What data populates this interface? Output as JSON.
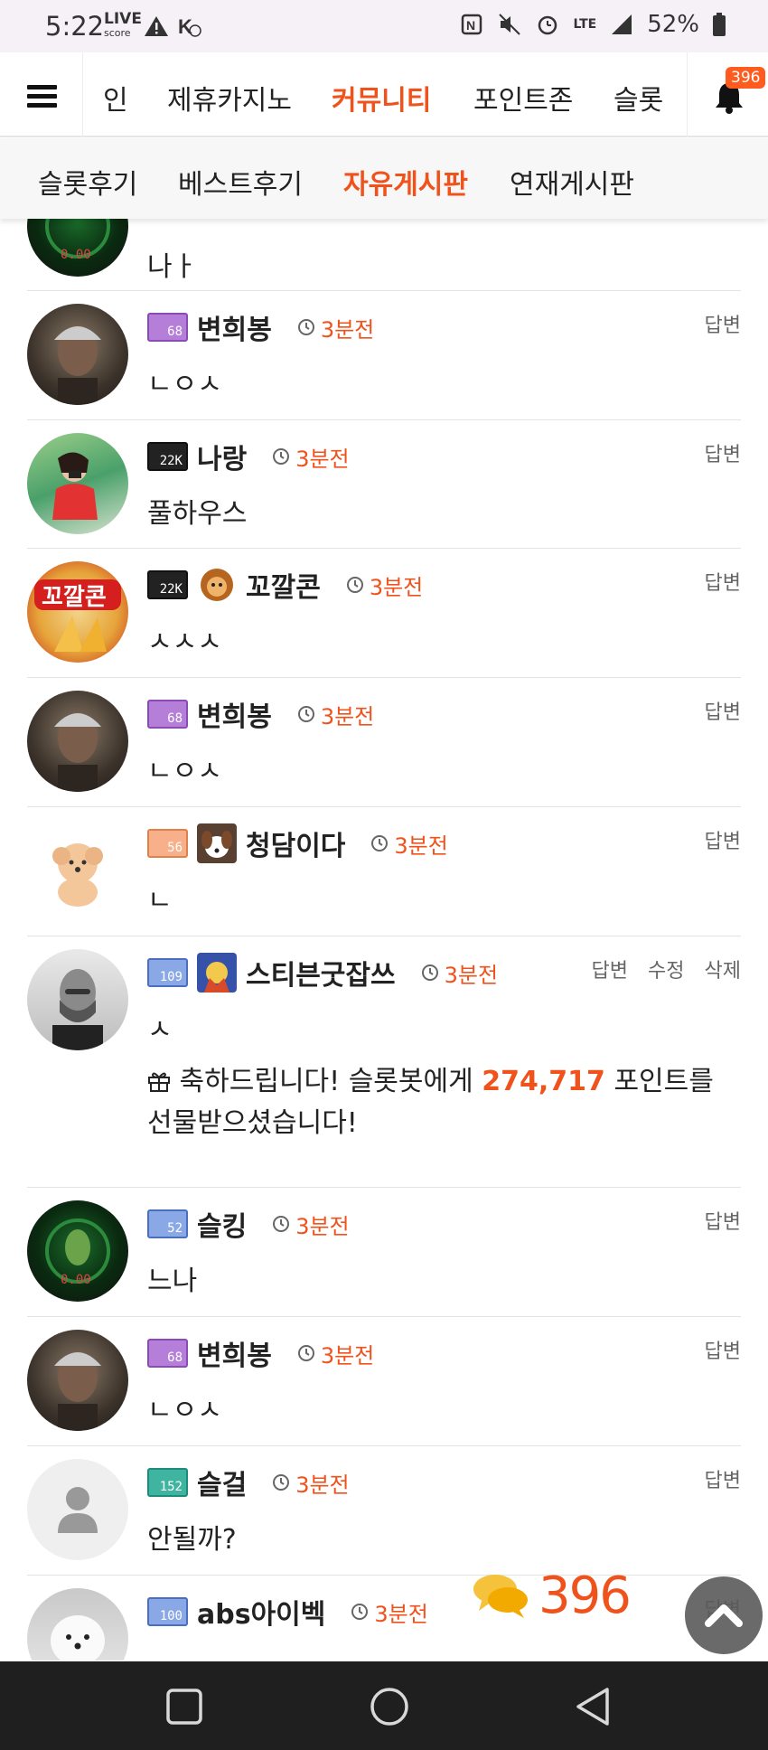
{
  "status_bar": {
    "time": "5:22",
    "live_label": "LIVE",
    "live_sub": "score",
    "lte": "LTE",
    "battery": "52%"
  },
  "top_nav": {
    "items": [
      {
        "label": "인",
        "active": false
      },
      {
        "label": "제휴카지노",
        "active": false
      },
      {
        "label": "커뮤니티",
        "active": true
      },
      {
        "label": "포인트존",
        "active": false
      },
      {
        "label": "슬롯",
        "active": false
      }
    ],
    "notification_count": "396"
  },
  "sub_nav": {
    "items": [
      {
        "label": "슬롯후기",
        "active": false
      },
      {
        "label": "베스트후기",
        "active": false
      },
      {
        "label": "자유게시판",
        "active": true
      },
      {
        "label": "연재게시판",
        "active": false
      }
    ]
  },
  "comments": [
    {
      "text": "나ㅏ"
    },
    {
      "nickname": "변희봉",
      "level": "68",
      "time": "3분전",
      "text": "ㄴㅇㅅ",
      "actions": [
        "답변"
      ]
    },
    {
      "nickname": "나랑",
      "level": "22K",
      "time": "3분전",
      "text": "풀하우스",
      "actions": [
        "답변"
      ]
    },
    {
      "nickname": "꼬깔콘",
      "level": "22K",
      "time": "3분전",
      "text": "ㅅㅅㅅ",
      "actions": [
        "답변"
      ]
    },
    {
      "nickname": "변희봉",
      "level": "68",
      "time": "3분전",
      "text": "ㄴㅇㅅ",
      "actions": [
        "답변"
      ]
    },
    {
      "nickname": "청담이다",
      "level": "56",
      "time": "3분전",
      "text": "ㄴ",
      "actions": [
        "답변"
      ]
    },
    {
      "nickname": "스티븐굿잡쓰",
      "level": "109",
      "time": "3분전",
      "text": "ㅅ",
      "actions": [
        "답변",
        "수정",
        "삭제"
      ],
      "gift": {
        "before": "축하드립니다! 슬롯봇에게",
        "points": "274,717",
        "after": "포인트를 선물받으셨습니다!"
      }
    },
    {
      "nickname": "슬킹",
      "level": "52",
      "time": "3분전",
      "text": "느나",
      "actions": [
        "답변"
      ]
    },
    {
      "nickname": "변희봉",
      "level": "68",
      "time": "3분전",
      "text": "ㄴㅇㅅ",
      "actions": [
        "답변"
      ]
    },
    {
      "nickname": "슬걸",
      "level": "152",
      "time": "3분전",
      "text": "안될까?",
      "actions": [
        "답변"
      ]
    },
    {
      "nickname": "abs아이벡",
      "level": "100",
      "time": "3분전",
      "text": "",
      "actions": [
        "답변"
      ]
    }
  ],
  "floating": {
    "comment_count": "396"
  },
  "colors": {
    "accent": "#f0521c",
    "badge": "#ff5b1f"
  }
}
